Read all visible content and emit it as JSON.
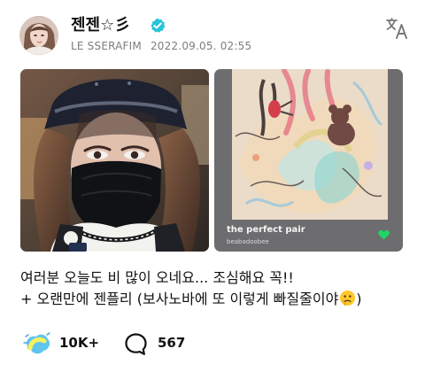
{
  "post": {
    "author_name": "젠젠☆彡",
    "group": "LE SSERAFIM",
    "timestamp": "2022.09.05. 02:55",
    "verified_icon": "verified-badge-icon",
    "translate_icon": "translate-icon",
    "caption_lines": [
      "여러분 오늘도 비 많이 오네요... 조심해요 꼭!!",
      "+ 오랜만에 젠플리 (보사노바에 또 이렇게 빠질줄이야",
      ")"
    ],
    "caption_emoji": "slightly-worried-face-icon"
  },
  "media": {
    "photo_icon": "selfie-photo",
    "music_card": {
      "title": "the perfect pair",
      "artist": "beabadoobee",
      "heart_icon": "heart-icon",
      "background_color": "#6d6d70",
      "heart_color": "#1ed760"
    }
  },
  "actions": {
    "likes": {
      "count": "10K+",
      "icon": "like-burst-icon",
      "accent": "#3da4df"
    },
    "comments": {
      "count": "567",
      "icon": "comment-bubble-icon"
    }
  }
}
